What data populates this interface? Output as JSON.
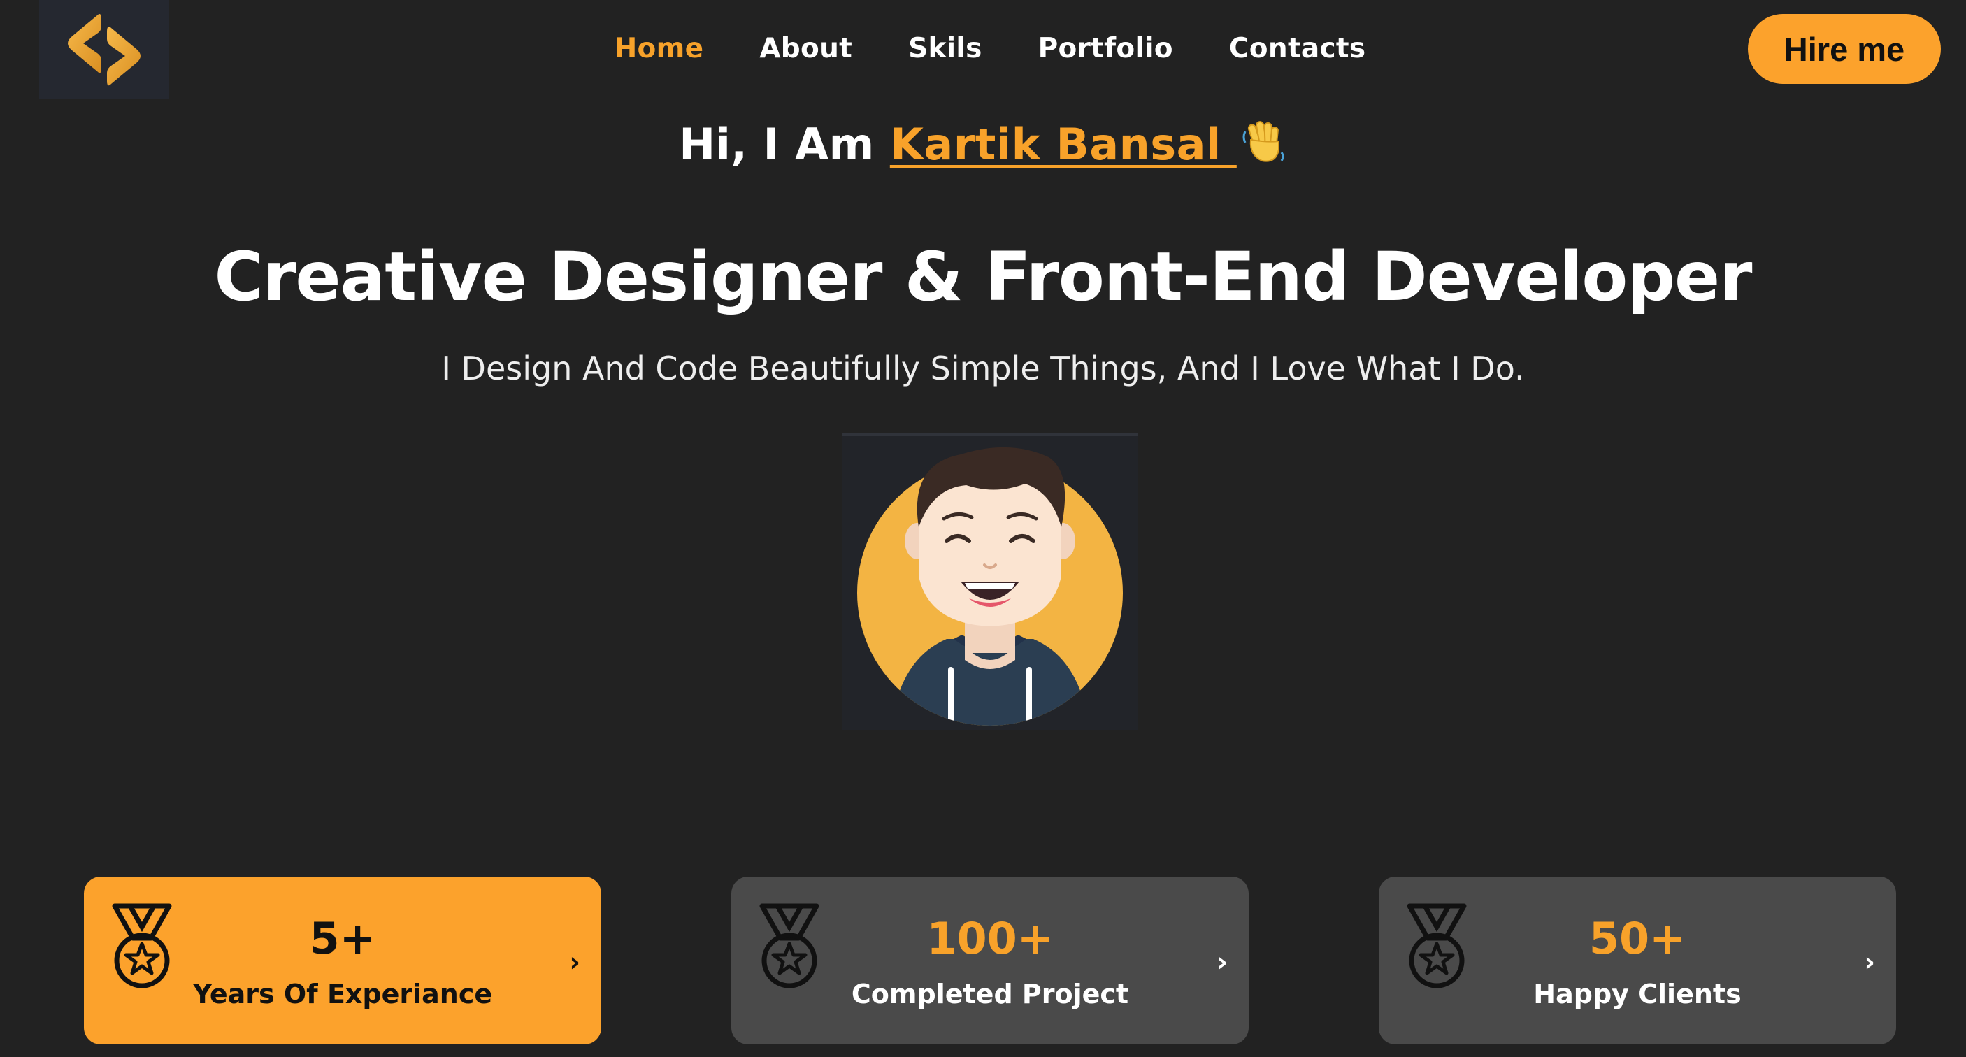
{
  "nav": {
    "logo_icon": "code-brackets-icon",
    "items": [
      {
        "label": "Home",
        "active": true
      },
      {
        "label": "About",
        "active": false
      },
      {
        "label": "Skils",
        "active": false
      },
      {
        "label": "Portfolio",
        "active": false
      },
      {
        "label": "Contacts",
        "active": false
      }
    ],
    "hire_label": "Hire me"
  },
  "hero": {
    "greeting_prefix": "Hi, I Am ",
    "name": "Kartik Bansal ",
    "wave_icon": "waving-hand-icon",
    "headline": "Creative Designer & Front-End Developer",
    "tagline": "I Design And Code Beautifully Simple Things, And I Love What I Do."
  },
  "stats": [
    {
      "value": "5+",
      "label": "Years Of Experiance",
      "icon": "medal-icon",
      "highlight": true
    },
    {
      "value": "100+",
      "label": "Completed Project",
      "icon": "medal-icon",
      "highlight": false
    },
    {
      "value": "50+",
      "label": "Happy Clients",
      "icon": "medal-icon",
      "highlight": false
    }
  ],
  "colors": {
    "background": "#222222",
    "accent": "#fca22c",
    "card": "#4a4a4a"
  }
}
